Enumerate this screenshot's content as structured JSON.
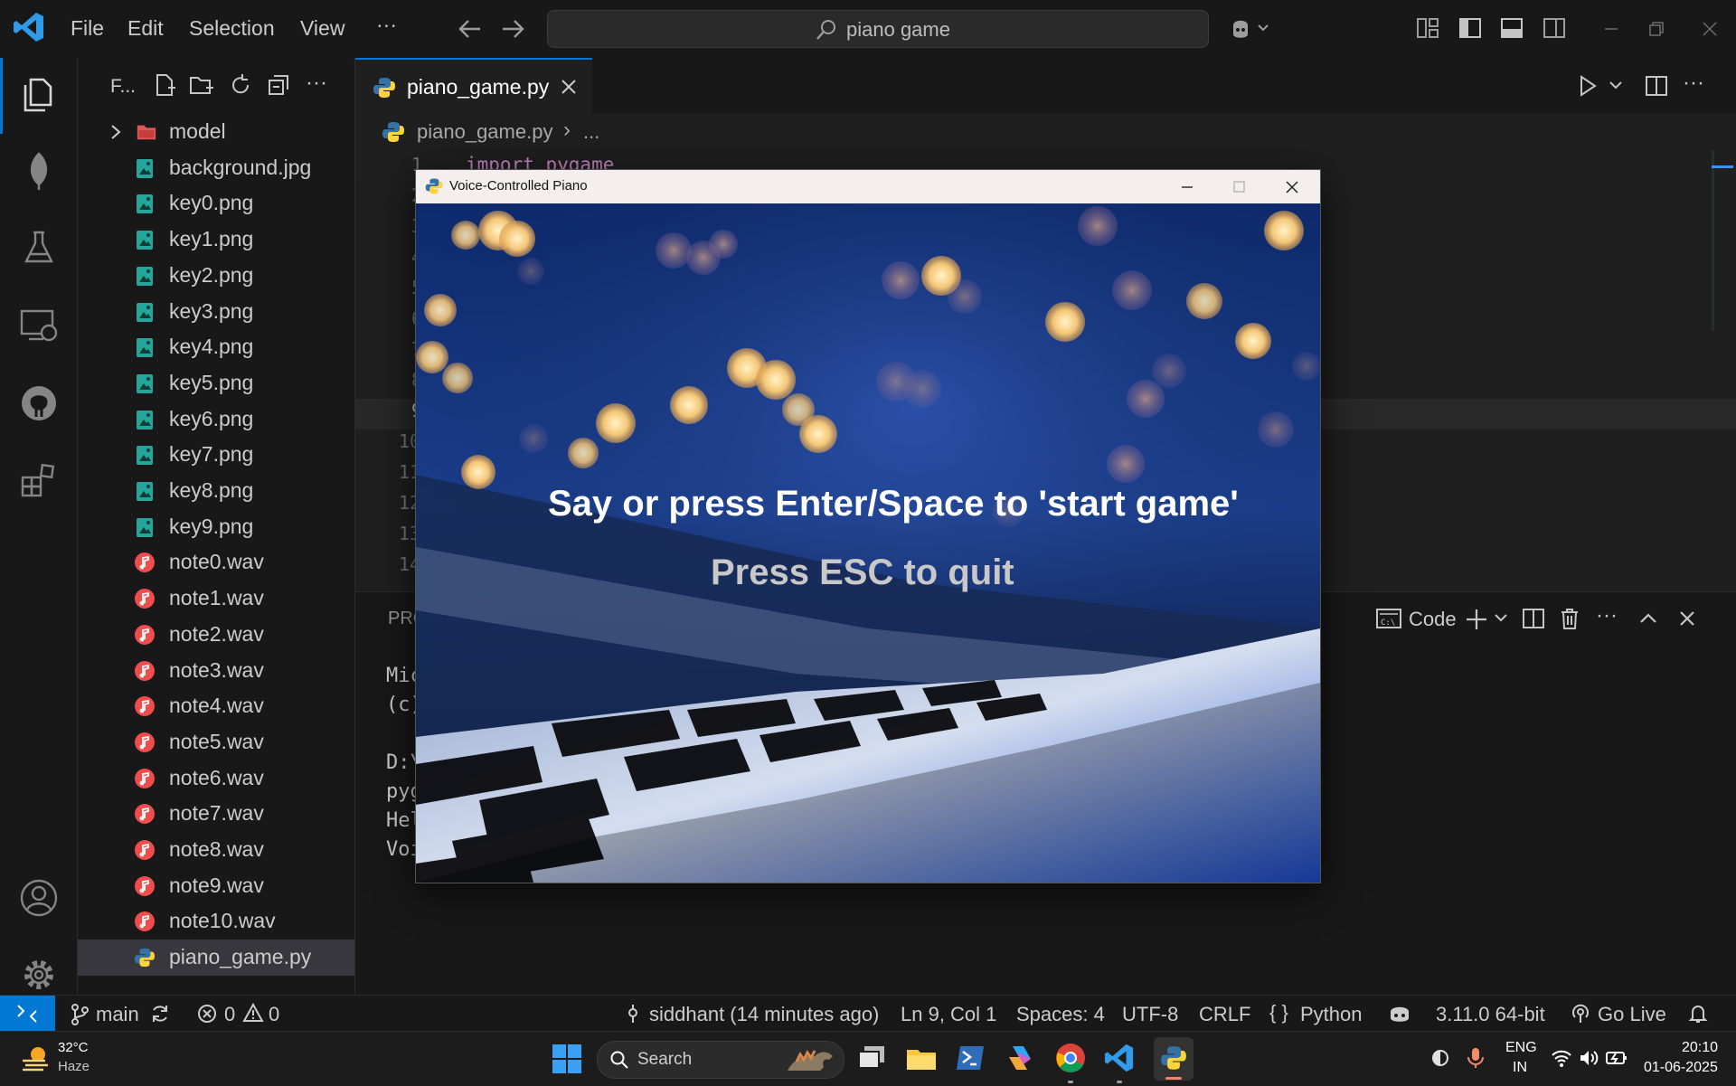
{
  "menu": {
    "file": "File",
    "edit": "Edit",
    "selection": "Selection",
    "view": "View",
    "more": "···"
  },
  "search": {
    "text": "piano game"
  },
  "explorer": {
    "title": "F...",
    "items": [
      {
        "label": "model",
        "type": "folder"
      },
      {
        "label": "background.jpg",
        "type": "image"
      },
      {
        "label": "key0.png",
        "type": "image"
      },
      {
        "label": "key1.png",
        "type": "image"
      },
      {
        "label": "key2.png",
        "type": "image"
      },
      {
        "label": "key3.png",
        "type": "image"
      },
      {
        "label": "key4.png",
        "type": "image"
      },
      {
        "label": "key5.png",
        "type": "image"
      },
      {
        "label": "key6.png",
        "type": "image"
      },
      {
        "label": "key7.png",
        "type": "image"
      },
      {
        "label": "key8.png",
        "type": "image"
      },
      {
        "label": "key9.png",
        "type": "image"
      },
      {
        "label": "note0.wav",
        "type": "audio"
      },
      {
        "label": "note1.wav",
        "type": "audio"
      },
      {
        "label": "note2.wav",
        "type": "audio"
      },
      {
        "label": "note3.wav",
        "type": "audio"
      },
      {
        "label": "note4.wav",
        "type": "audio"
      },
      {
        "label": "note5.wav",
        "type": "audio"
      },
      {
        "label": "note6.wav",
        "type": "audio"
      },
      {
        "label": "note7.wav",
        "type": "audio"
      },
      {
        "label": "note8.wav",
        "type": "audio"
      },
      {
        "label": "note9.wav",
        "type": "audio"
      },
      {
        "label": "note10.wav",
        "type": "audio"
      },
      {
        "label": "piano_game.py",
        "type": "python",
        "selected": true
      }
    ]
  },
  "tab": {
    "label": "piano_game.py"
  },
  "breadcrumb": {
    "file": "piano_game.py",
    "rest": "..."
  },
  "editor": {
    "first_line_num": "1",
    "first_line_code": "import pygame",
    "line_numbers": [
      "1",
      "2",
      "3",
      "4",
      "5",
      "6",
      "7",
      "8",
      "9",
      "10",
      "11",
      "12",
      "13",
      "14"
    ]
  },
  "panel": {
    "tab_prefix": "PRO",
    "terminal_name": "Code",
    "terminal_lines": [
      "Mic",
      "(c)",
      "",
      "D:\\",
      "pyg",
      "Hel",
      "Voi"
    ]
  },
  "game_window": {
    "title": "Voice-Controlled Piano",
    "line1": "Say or press Enter/Space to 'start game'",
    "line2": "Press ESC to quit"
  },
  "statusbar": {
    "branch": "main",
    "errors": "0",
    "warnings": "0",
    "author": "siddhant (14 minutes ago)",
    "position": "Ln 9, Col 1",
    "spaces": "Spaces: 4",
    "encoding": "UTF-8",
    "eol": "CRLF",
    "language": "Python",
    "interpreter": "3.11.0 64-bit",
    "golive": "Go Live"
  },
  "taskbar": {
    "temp": "32°C",
    "weather": "Haze",
    "search": "Search",
    "lang1": "ENG",
    "lang2": "IN",
    "time": "20:10",
    "date": "01-06-2025"
  },
  "colors": {
    "accent": "#0078d4",
    "python_blue": "#3572a5",
    "audio_red": "#f14c4c",
    "image_teal": "#26a69a",
    "remote_blue": "#0078d4"
  }
}
